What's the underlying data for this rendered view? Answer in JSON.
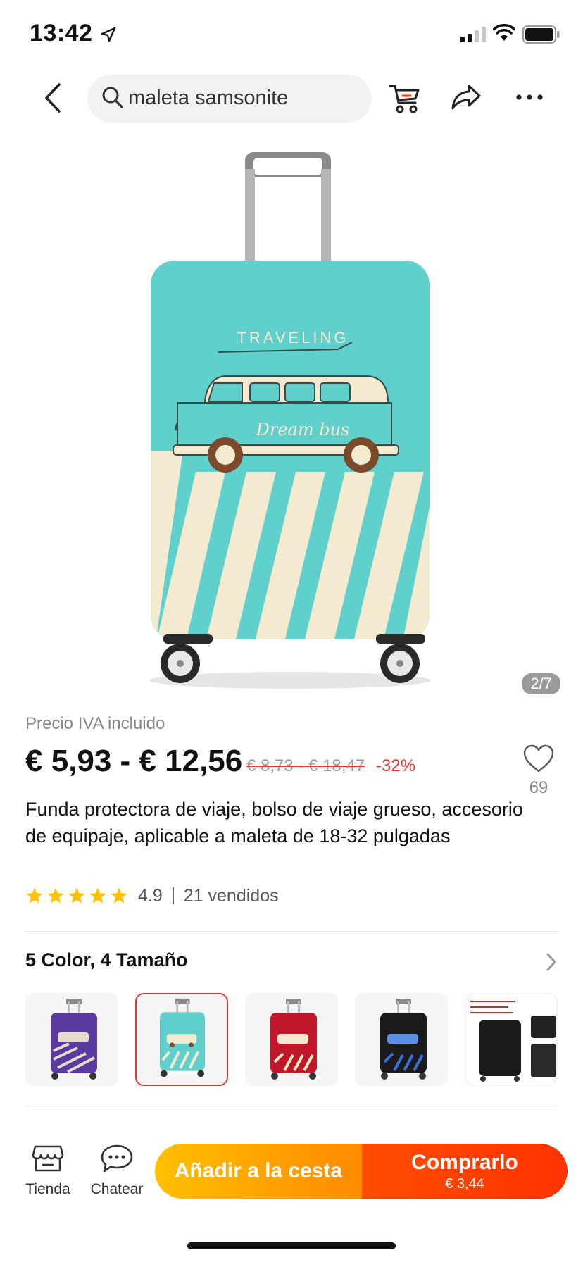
{
  "status_bar": {
    "time": "13:42"
  },
  "search": {
    "query": "maleta samsonite"
  },
  "gallery": {
    "counter": "2/7",
    "print_title": "TRAVELING",
    "print_bus_text": "Dream bus"
  },
  "product": {
    "tax_label": "Precio IVA incluido",
    "price_range": "€ 5,93 - € 12,56",
    "original_price": "€ 8,73 - € 18,47",
    "discount": "-32%",
    "wishlist_count": "69",
    "title": "Funda protectora de viaje, bolso de viaje grueso, accesorio de equipaje, aplicable a maleta de 18-32 pulgadas",
    "rating": "4.9",
    "sold": "21 vendidos",
    "stars": 5
  },
  "variants": {
    "title": "5 Color, 4 Tamaño",
    "items": [
      {
        "name": "purple",
        "color": "#5a3aa0"
      },
      {
        "name": "teal",
        "color": "#5fd0c8",
        "selected": true
      },
      {
        "name": "red",
        "color": "#c0182a"
      },
      {
        "name": "black",
        "color": "#1a1a1a"
      },
      {
        "name": "black-cover-detail",
        "color": "#222222"
      }
    ]
  },
  "bottom_bar": {
    "store_label": "Tienda",
    "chat_label": "Chatear",
    "add_to_cart": "Añadir a la cesta",
    "buy_now": "Comprarlo",
    "buy_price": "€ 3,44"
  },
  "colors": {
    "accent_red": "#e53935",
    "cart_yellow": "#ffc000",
    "buy_orange": "#ff4d00",
    "suitcase_teal": "#5fd0cc"
  }
}
